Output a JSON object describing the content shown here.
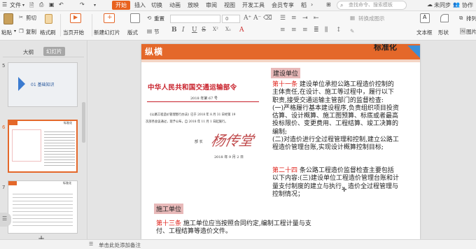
{
  "menubar": {
    "file": "文件",
    "tabs": [
      "开始",
      "插入",
      "切换",
      "动画",
      "放映",
      "审阅",
      "视图",
      "开发工具",
      "会员专享",
      "稻"
    ],
    "search_placeholder": "查找命令、搜索模板",
    "cloud": "未同步",
    "collab": "协作"
  },
  "ribbon": {
    "paste": "粘贴",
    "cut": "剪切",
    "copy": "复制",
    "format_painter": "格式刷",
    "from_current": "当页开始",
    "new_slide": "新建幻灯片",
    "layout": "版式",
    "section": "节",
    "reset": "重置",
    "font_size": "0",
    "text_box": "文本框",
    "shape": "形状",
    "arrange": "排列",
    "picture": "图片",
    "text_tool_btns": [
      "B",
      "I",
      "U",
      "S",
      "X²",
      "X₂",
      "A"
    ],
    "convert_smartart": "转换成图示"
  },
  "panel": {
    "tab_outline": "大纲",
    "tab_slides": "幻灯片",
    "slides": [
      {
        "num": "5",
        "title": "01 基础知识"
      },
      {
        "num": "6",
        "header": "标准化"
      },
      {
        "num": "7",
        "header": "标准化"
      }
    ],
    "add": "+"
  },
  "slide": {
    "brand": "纵横",
    "top_right": "标准化",
    "doc": {
      "title": "中华人民共和国交通运输部令",
      "number": "2018 年第 67 号",
      "line1": "《公路工程造价管理暂行办法》已于 2018 年 8 月 31 日经第 19",
      "line2": "次部务会议通过，现予公布，自 2018 年 11 月 1 日起施行。",
      "minister_label": "部  长",
      "signature": "杨传堂",
      "date": "2018 年 9 月 2 日"
    },
    "section1_head": "建设单位",
    "art11_title": "第十一条",
    "art11_lines": [
      "建设单位承担公路工程造价控制的",
      "主体责任,在设计、施工等过程中，履行以下",
      "职责,接受交通运输主管部门的监督检查:",
      "(一)严格履行基本建设程序,负责组织项目投资",
      "估算、设计概算、施工图预算、标底或者最高",
      "投标限价、变更费用、工程结算、竣工决算的",
      "编制;",
      "(二)对造价进行全过程管理和控制,建立公路工",
      "程造价管理台账,实现设计概算控制目标;"
    ],
    "art24_title": "第二十四",
    "art24_lines": [
      "条公路工程造价监督检查主要包括",
      "以下内容:(三)建设单位工程造价管理台账和计",
      "量支付制度的建立与执行、造价全过程管理与",
      "控制情况；"
    ],
    "section2_head": "施工单位",
    "art13_title": "第十三条",
    "art13_lines": [
      "施工单位应当按照合同约定,编制工程计量与支",
      "付、工程结算等造价文件。"
    ]
  },
  "status": {
    "notes_placeholder": "单击此处添加备注"
  },
  "colors": {
    "accent": "#e4682a",
    "red_text": "#e0241c",
    "section_bg": "#e8b9b9",
    "doc_red": "#c8202a"
  }
}
